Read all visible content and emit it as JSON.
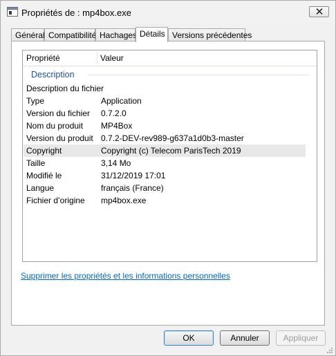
{
  "window": {
    "title": "Propriétés de : mp4box.exe"
  },
  "tabs": [
    {
      "label": "Général"
    },
    {
      "label": "Compatibilité"
    },
    {
      "label": "Hachages"
    },
    {
      "label": "Détails"
    },
    {
      "label": "Versions précédentes"
    }
  ],
  "active_tab": "Détails",
  "table": {
    "headers": {
      "property": "Propriété",
      "value": "Valeur"
    },
    "group": "Description",
    "rows": [
      {
        "name": "Description du fichier",
        "value": ""
      },
      {
        "name": "Type",
        "value": "Application"
      },
      {
        "name": "Version du fichier",
        "value": "0.7.2.0"
      },
      {
        "name": "Nom du produit",
        "value": "MP4Box"
      },
      {
        "name": "Version du produit",
        "value": "0.7.2-DEV-rev989-g637a1d0b3-master"
      },
      {
        "name": "Copyright",
        "value": "Copyright (c) Telecom ParisTech 2019"
      },
      {
        "name": "Taille",
        "value": "3,14 Mo"
      },
      {
        "name": "Modifié le",
        "value": "31/12/2019 17:01"
      },
      {
        "name": "Langue",
        "value": "français (France)"
      },
      {
        "name": "Fichier d’origine",
        "value": "mp4box.exe"
      }
    ]
  },
  "link": "Supprimer les propriétés et les informations personnelles",
  "buttons": {
    "ok": "OK",
    "cancel": "Annuler",
    "apply": "Appliquer"
  }
}
